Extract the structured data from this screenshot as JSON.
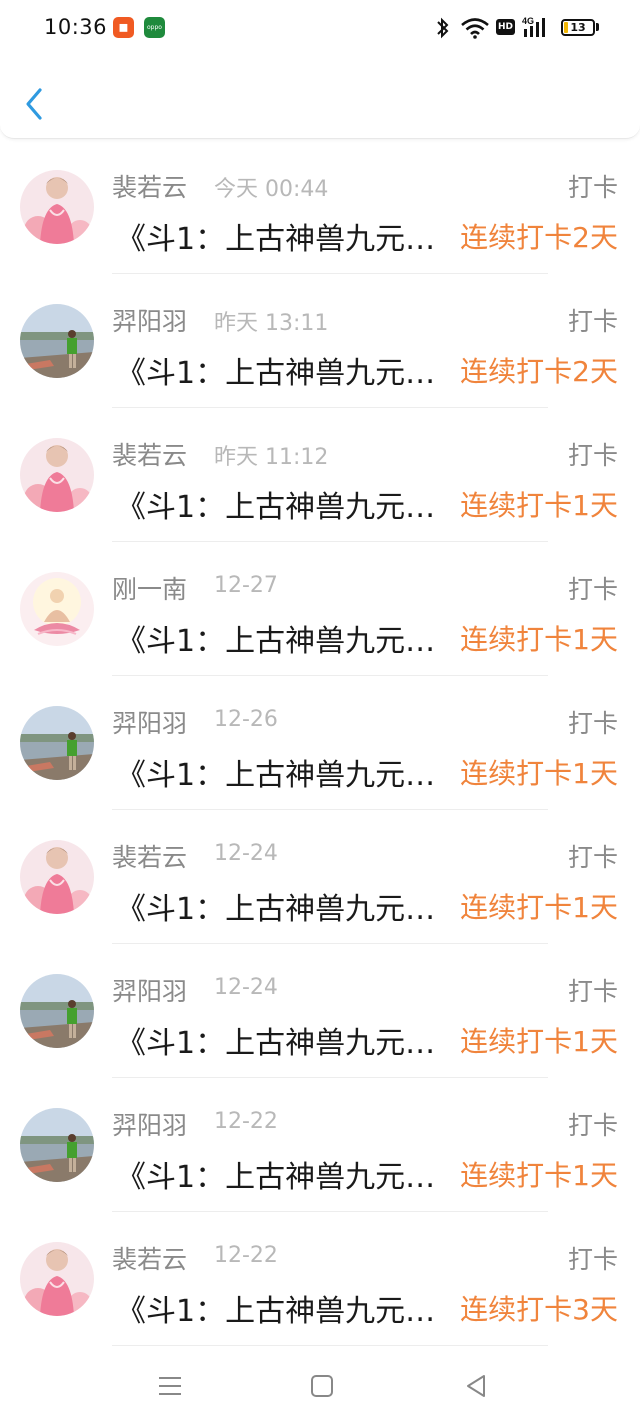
{
  "status_bar": {
    "time": "10:36",
    "network": "4G",
    "hd_label": "HD",
    "battery": "13",
    "battery_level": 0.13
  },
  "header": {
    "back_icon": "chevron-left-icon",
    "accent": "#2f9ae0"
  },
  "colors": {
    "streak": "#f0843c",
    "muted": "#8a8a8a",
    "time": "#b8b8b8"
  },
  "entries": [
    {
      "name": "裴若云",
      "time": "今天 00:44",
      "action": "打卡",
      "title": "《斗1：上古神兽九元…",
      "streak": "连续打卡2天",
      "avatar": "avatar-woman-pink"
    },
    {
      "name": "羿阳羽",
      "time": "昨天 13:11",
      "action": "打卡",
      "title": "《斗1：上古神兽九元…",
      "streak": "连续打卡2天",
      "avatar": "avatar-lakeside"
    },
    {
      "name": "裴若云",
      "time": "昨天 11:12",
      "action": "打卡",
      "title": "《斗1：上古神兽九元…",
      "streak": "连续打卡1天",
      "avatar": "avatar-woman-pink"
    },
    {
      "name": "刚一南",
      "time": "12-27",
      "action": "打卡",
      "title": "《斗1：上古神兽九元…",
      "streak": "连续打卡1天",
      "avatar": "avatar-buddha"
    },
    {
      "name": "羿阳羽",
      "time": "12-26",
      "action": "打卡",
      "title": "《斗1：上古神兽九元…",
      "streak": "连续打卡1天",
      "avatar": "avatar-lakeside"
    },
    {
      "name": "裴若云",
      "time": "12-24",
      "action": "打卡",
      "title": "《斗1：上古神兽九元…",
      "streak": "连续打卡1天",
      "avatar": "avatar-woman-pink"
    },
    {
      "name": "羿阳羽",
      "time": "12-24",
      "action": "打卡",
      "title": "《斗1：上古神兽九元…",
      "streak": "连续打卡1天",
      "avatar": "avatar-lakeside"
    },
    {
      "name": "羿阳羽",
      "time": "12-22",
      "action": "打卡",
      "title": "《斗1：上古神兽九元…",
      "streak": "连续打卡1天",
      "avatar": "avatar-lakeside"
    },
    {
      "name": "裴若云",
      "time": "12-22",
      "action": "打卡",
      "title": "《斗1：上古神兽九元…",
      "streak": "连续打卡3天",
      "avatar": "avatar-woman-pink"
    }
  ],
  "nav": {
    "menu_icon": "menu-icon",
    "home_icon": "home-icon",
    "back_icon": "back-triangle-icon"
  }
}
